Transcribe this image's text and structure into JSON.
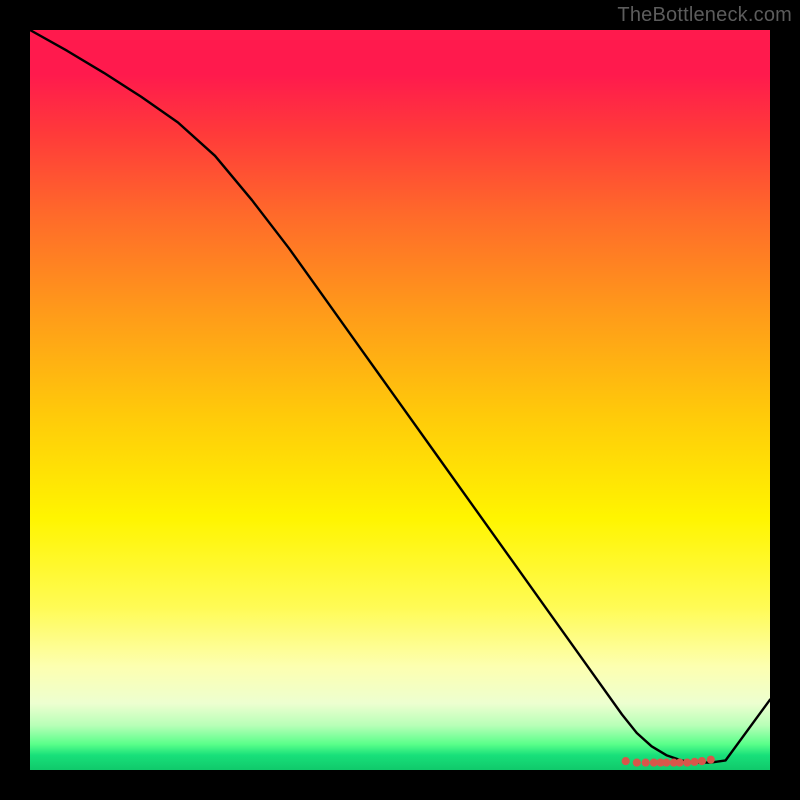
{
  "watermark": "TheBottleneck.com",
  "chart_data": {
    "type": "line",
    "title": "",
    "xlabel": "",
    "ylabel": "",
    "xlim": [
      0,
      100
    ],
    "ylim": [
      0,
      100
    ],
    "grid": false,
    "legend": false,
    "series": [
      {
        "name": "curve",
        "x": [
          0,
          5,
          10,
          15,
          20,
          25,
          30,
          35,
          40,
          45,
          50,
          55,
          60,
          65,
          70,
          75,
          80,
          82,
          84,
          86,
          88,
          90,
          92,
          94,
          100
        ],
        "values": [
          100,
          97.2,
          94.2,
          91.0,
          87.5,
          83.0,
          77.0,
          70.5,
          63.5,
          56.5,
          49.5,
          42.5,
          35.5,
          28.5,
          21.5,
          14.5,
          7.5,
          5.0,
          3.2,
          2.0,
          1.3,
          1.0,
          1.0,
          1.3,
          9.5
        ]
      },
      {
        "name": "markers",
        "x": [
          80.5,
          82.0,
          83.2,
          84.3,
          85.2,
          86.0,
          87.0,
          87.8,
          88.8,
          89.8,
          90.8,
          92.0
        ],
        "values": [
          1.2,
          1.0,
          1.0,
          1.0,
          1.0,
          1.0,
          1.0,
          1.0,
          1.0,
          1.1,
          1.2,
          1.4
        ]
      }
    ]
  }
}
